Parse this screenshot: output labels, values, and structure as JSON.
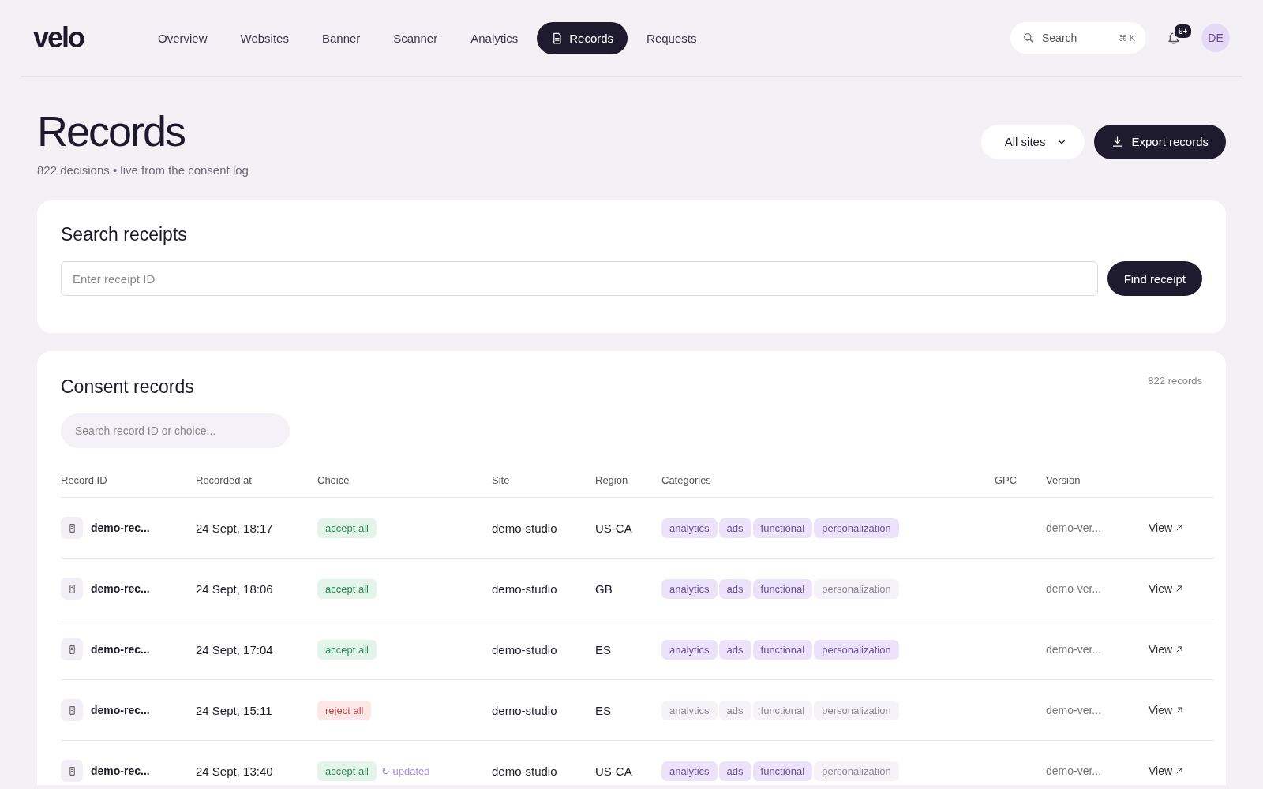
{
  "header": {
    "logo": "velo",
    "nav": [
      {
        "label": "Overview",
        "selected": false
      },
      {
        "label": "Websites",
        "selected": false
      },
      {
        "label": "Banner",
        "selected": false
      },
      {
        "label": "Scanner",
        "selected": false
      },
      {
        "label": "Analytics",
        "selected": false
      },
      {
        "label": "Records",
        "selected": true
      },
      {
        "label": "Requests",
        "selected": false
      }
    ],
    "search": {
      "placeholder": "Search",
      "shortcut": "⌘ K"
    },
    "notifications": "9+",
    "avatar": "DE"
  },
  "page": {
    "title": "Records",
    "subtitle": "822 decisions • live from the consent log",
    "site_filter": "All sites",
    "export_button": "Export records"
  },
  "receipt_search": {
    "title": "Search receipts",
    "placeholder": "Enter receipt ID",
    "button": "Find receipt"
  },
  "consent_records": {
    "title": "Consent records",
    "count": "822 records",
    "search": {
      "placeholder": "Search record ID or choice..."
    },
    "columns": [
      "Record ID",
      "Recorded at",
      "Choice",
      "Site",
      "Region",
      "Categories",
      "GPC",
      "Version"
    ],
    "rows": [
      {
        "id": "demo-rec...",
        "time": "24 Sept, 18:17",
        "choice": {
          "kind": "accept",
          "label": "accept all"
        },
        "site": "demo-studio",
        "region": "US-CA",
        "categories": [
          {
            "label": "analytics",
            "on": true
          },
          {
            "label": "ads",
            "on": true
          },
          {
            "label": "functional",
            "on": true
          },
          {
            "label": "personalization",
            "on": true
          }
        ],
        "version": "demo-ver...",
        "action": "View"
      },
      {
        "id": "demo-rec...",
        "time": "24 Sept, 18:06",
        "choice": {
          "kind": "accept",
          "label": "accept all"
        },
        "site": "demo-studio",
        "region": "GB",
        "categories": [
          {
            "label": "analytics",
            "on": true
          },
          {
            "label": "ads",
            "on": true
          },
          {
            "label": "functional",
            "on": true
          },
          {
            "label": "personalization",
            "on": false
          }
        ],
        "version": "demo-ver...",
        "action": "View"
      },
      {
        "id": "demo-rec...",
        "time": "24 Sept, 17:04",
        "choice": {
          "kind": "accept",
          "label": "accept all"
        },
        "site": "demo-studio",
        "region": "ES",
        "categories": [
          {
            "label": "analytics",
            "on": true
          },
          {
            "label": "ads",
            "on": true
          },
          {
            "label": "functional",
            "on": true
          },
          {
            "label": "personalization",
            "on": true
          }
        ],
        "version": "demo-ver...",
        "action": "View"
      },
      {
        "id": "demo-rec...",
        "time": "24 Sept, 15:11",
        "choice": {
          "kind": "reject",
          "label": "reject all"
        },
        "site": "demo-studio",
        "region": "ES",
        "categories": [
          {
            "label": "analytics",
            "on": false
          },
          {
            "label": "ads",
            "on": false
          },
          {
            "label": "functional",
            "on": false
          },
          {
            "label": "personalization",
            "on": false
          }
        ],
        "version": "demo-ver...",
        "action": "View"
      },
      {
        "id": "demo-rec...",
        "time": "24 Sept, 13:40",
        "choice": {
          "kind": "accept",
          "label": "accept all"
        },
        "note": "↻ updated",
        "site": "demo-studio",
        "region": "US-CA",
        "categories": [
          {
            "label": "analytics",
            "on": true
          },
          {
            "label": "ads",
            "on": true
          },
          {
            "label": "functional",
            "on": true
          },
          {
            "label": "personalization",
            "on": false
          }
        ],
        "version": "demo-ver...",
        "action": "View"
      }
    ]
  }
}
